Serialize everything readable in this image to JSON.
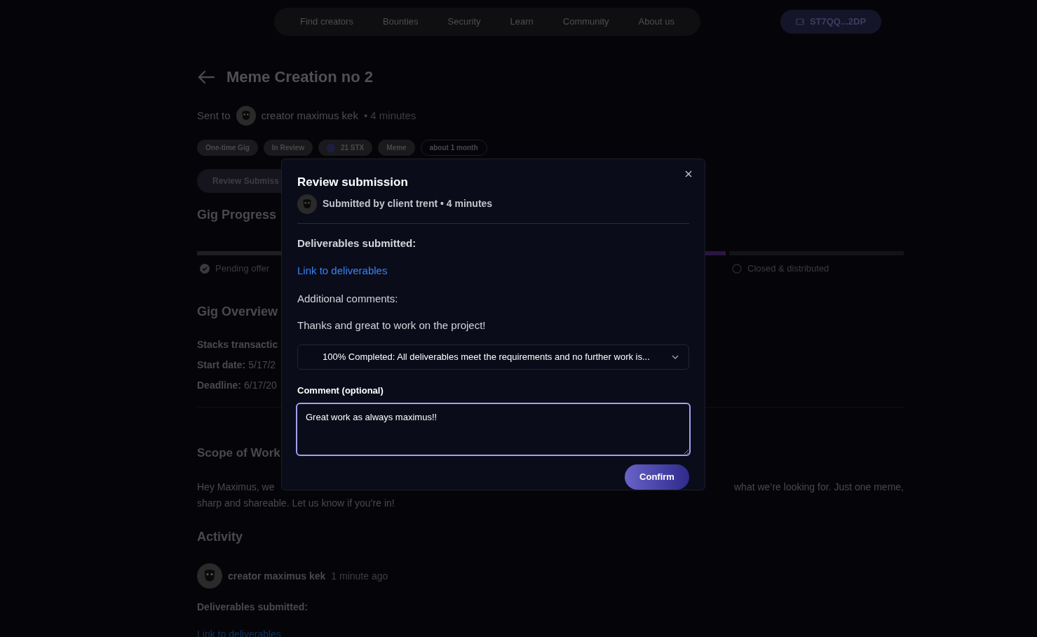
{
  "nav": {
    "links": [
      "Find creators",
      "Bounties",
      "Security",
      "Learn",
      "Community",
      "About us"
    ],
    "wallet": "ST7QQ...2DP"
  },
  "gig": {
    "title": "Meme Creation no 2",
    "sent_to_label": "Sent to",
    "recipient": "creator maximus kek",
    "time": "• 4 minutes",
    "tags": [
      {
        "label": "One-time Gig",
        "kind": "filled"
      },
      {
        "label": "In Review",
        "kind": "filled"
      },
      {
        "label": "21 STX",
        "kind": "token"
      },
      {
        "label": "Meme",
        "kind": "filled"
      },
      {
        "label": "about 1 month",
        "kind": "outline"
      }
    ],
    "review_button": "Review Submiss",
    "progress_title": "Gig Progress",
    "steps": [
      {
        "label": "Pending offer",
        "done": true,
        "current": false
      },
      {
        "done": false,
        "current": true
      },
      {
        "label": "Closed & distributed",
        "done": false,
        "current": false
      }
    ],
    "overview_title": "Gig Overview",
    "overview": [
      {
        "key": "Stacks transactic"
      },
      {
        "key": "Start date:",
        "value": "5/17/2"
      },
      {
        "key": "Deadline:",
        "value": "6/17/20"
      }
    ],
    "scope_title": "Scope of Work",
    "scope_left": "Hey Maximus, we",
    "scope_right": "what we’re looking for. Just one meme,",
    "scope_line2": "sharp and shareable. Let us know if you’re in!",
    "activity_title": "Activity",
    "activity": {
      "author": "creator maximus kek",
      "time": "1 minute ago",
      "heading": "Deliverables submitted:",
      "link": "Link to deliverables"
    }
  },
  "modal": {
    "title": "Review submission",
    "subtitle": "Submitted by client trent • 4 minutes",
    "deliverables_heading": "Deliverables submitted:",
    "link": "Link to deliverables",
    "comments_heading": "Additional comments:",
    "comments": "Thanks and great to work on the project!",
    "select_value": "100% Completed: All deliverables meet the requirements and no further work is...",
    "comment_label": "Comment (optional)",
    "comment_value": "Great work as always maximus!!",
    "confirm": "Confirm"
  }
}
